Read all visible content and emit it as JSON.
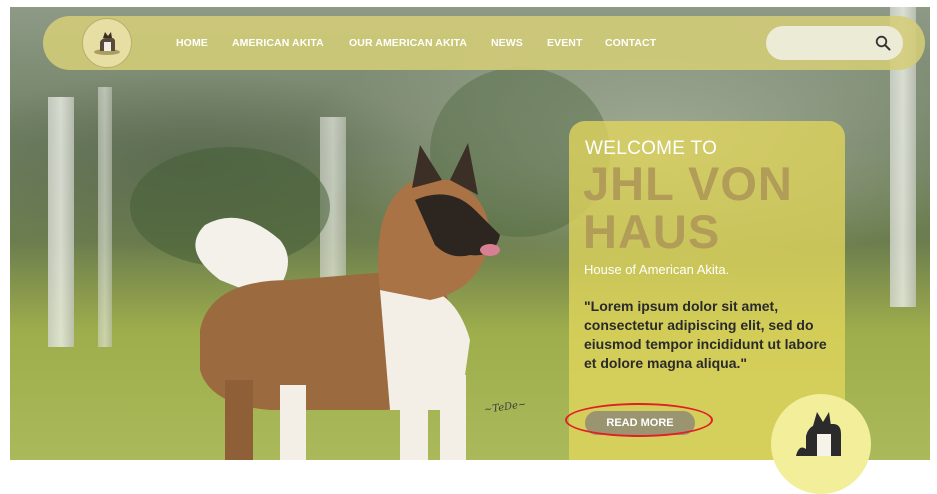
{
  "nav": {
    "items": [
      {
        "label": "HOME"
      },
      {
        "label": "AMERICAN AKITA"
      },
      {
        "label": "OUR AMERICAN AKITA"
      },
      {
        "label": "NEWS"
      },
      {
        "label": "EVENT"
      },
      {
        "label": "CONTACT"
      }
    ],
    "search": {
      "placeholder": "",
      "icon": "search-icon"
    }
  },
  "hero": {
    "welcome": "WELCOME TO",
    "brand_line1": "JHL VON",
    "brand_line2": "HAUS",
    "tagline": "House of American Akita.",
    "quote": "\"Lorem ipsum dolor sit amet, consectetur adipiscing elit, sed do eiusmod tempor incididunt ut labore et dolore magna aliqua.\"",
    "button": "READ MORE"
  },
  "colors": {
    "navbar": "#d4cd78",
    "card": "#e2d65c",
    "brand_text": "#b19c58",
    "button": "#9b9470",
    "highlight": "#e21f26"
  }
}
